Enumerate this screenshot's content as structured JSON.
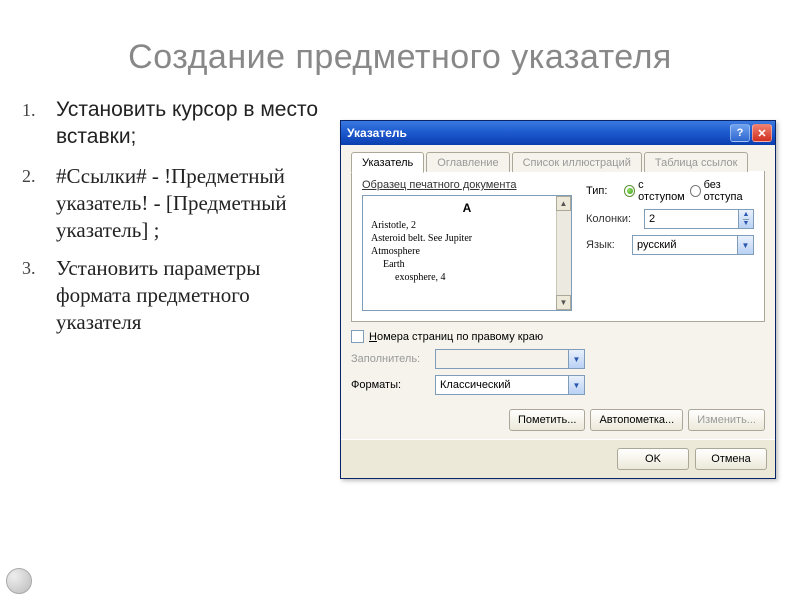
{
  "slide": {
    "title": "Создание предметного указателя",
    "items": [
      "Установить курсор в место вставки;",
      "#Ссылки#  -  !Предметный указатель! - [Предметный указатель] ;",
      "Установить параметры формата предметного указателя"
    ]
  },
  "dialog": {
    "title": "Указатель",
    "tabs": [
      "Указатель",
      "Оглавление",
      "Список иллюстраций",
      "Таблица ссылок"
    ],
    "active_tab": 0,
    "preview_label": "Образец печатного документа",
    "preview": {
      "heading": "A",
      "lines": [
        "Aristotle, 2",
        "Asteroid belt. See Jupiter",
        "Atmosphere",
        "Earth",
        "exosphere, 4"
      ]
    },
    "type": {
      "label": "Тип:",
      "options": [
        "с отступом",
        "без отступа"
      ],
      "selected": 0
    },
    "columns": {
      "label": "Колонки:",
      "value": "2"
    },
    "language": {
      "label": "Язык:",
      "value": "русский"
    },
    "right_align": {
      "label": "Номера страниц по правому краю",
      "checked": false
    },
    "leader": {
      "label": "Заполнитель:",
      "value": ""
    },
    "format": {
      "label": "Форматы:",
      "value": "Классический"
    },
    "buttons": {
      "mark": "Пометить...",
      "automark": "Автопометка...",
      "modify": "Изменить...",
      "ok": "OK",
      "cancel": "Отмена"
    },
    "help_icon": "?",
    "close_icon": "✕"
  }
}
